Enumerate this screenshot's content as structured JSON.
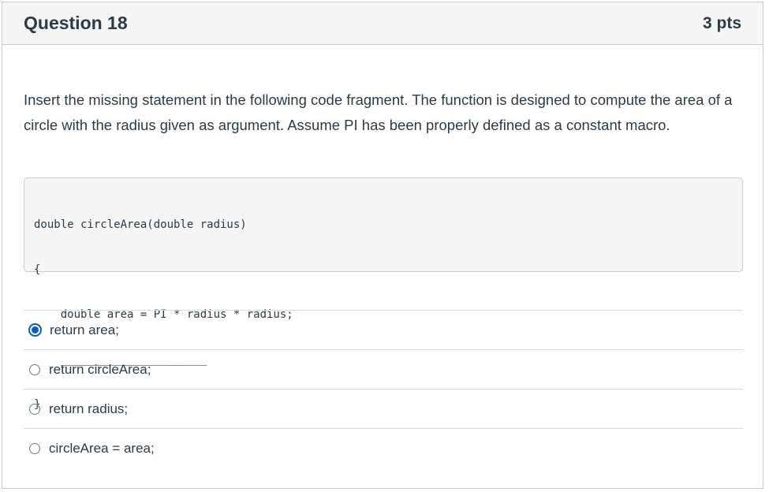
{
  "question": {
    "title": "Question 18",
    "points": "3 pts",
    "prompt": "Insert the missing statement in the following code fragment. The function is designed to compute the area of a circle with the radius given as argument. Assume PI has been properly defined as a constant macro.",
    "code_lines": [
      "double circleArea(double radius)",
      "{",
      "    double area = PI * radius * radius;",
      "    ______________________",
      "}"
    ]
  },
  "answers": [
    {
      "label": "return area;",
      "selected": true
    },
    {
      "label": "return circleArea;",
      "selected": false
    },
    {
      "label": "return radius;",
      "selected": false
    },
    {
      "label": "circleArea = area;",
      "selected": false
    }
  ],
  "colors": {
    "accent": "#0b59c8",
    "header_bg": "#f5f5f5",
    "text": "#2d3b45"
  }
}
